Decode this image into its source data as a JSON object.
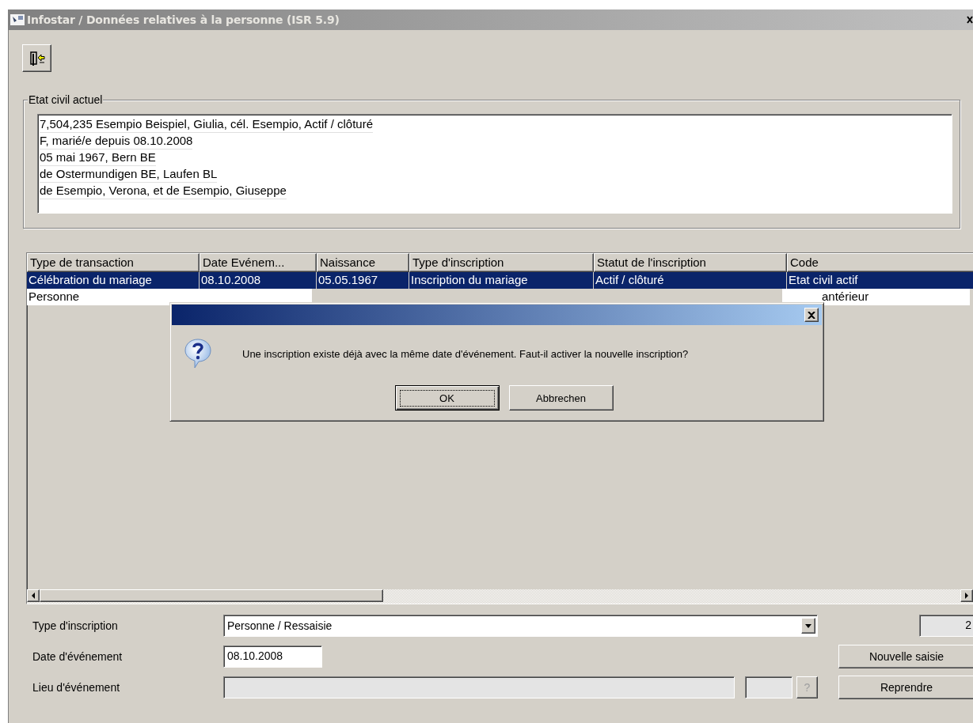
{
  "window": {
    "title": "Infostar / Données relatives à la personne (ISR 5.9)"
  },
  "current_status": {
    "title": "Etat civil actuel",
    "lines": [
      "7,504,235  Esempio Beispiel, Giulia, cél. Esempio, Actif / clôturé",
      "F, marié/e depuis 08.10.2008",
      "05 mai 1967, Bern BE",
      "de Ostermundigen BE, Laufen BL",
      "de Esempio, Verona, et de Esempio, Giuseppe"
    ]
  },
  "table": {
    "columns": [
      "Type de transaction",
      "Date Evénem...",
      "Naissance",
      "Type d'inscription",
      "Statut de l'inscription",
      "Code"
    ],
    "rows": [
      {
        "selected": true,
        "transaction_type": "Célébration du mariage",
        "event_date": "08.10.2008",
        "birth": "05.05.1967",
        "inscription_type": "Inscription du mariage",
        "inscription_status": "Actif / clôturé",
        "code": "Etat civil actif"
      },
      {
        "selected": false,
        "transaction_type": "Personne",
        "code": "antérieur"
      }
    ]
  },
  "dialog": {
    "message": "Une inscription existe déjà avec la même date d'événement. Faut-il activer la nouvelle inscription?",
    "buttons": [
      {
        "label": "OK",
        "focused": true
      },
      {
        "label": "Abbrechen",
        "focused": false
      }
    ]
  },
  "form": {
    "inscription_type": {
      "label": "Type d'inscription",
      "value": "Personne / Ressaisie"
    },
    "counter": "2",
    "event_date": {
      "label": "Date d'événement",
      "value": "08.10.2008"
    },
    "event_place": {
      "label": "Lieu d'événement",
      "disabled": true
    },
    "lookup_button": {
      "label": "?",
      "disabled": true
    },
    "buttons": [
      "Nouvelle saisie",
      "Reprendre"
    ]
  }
}
